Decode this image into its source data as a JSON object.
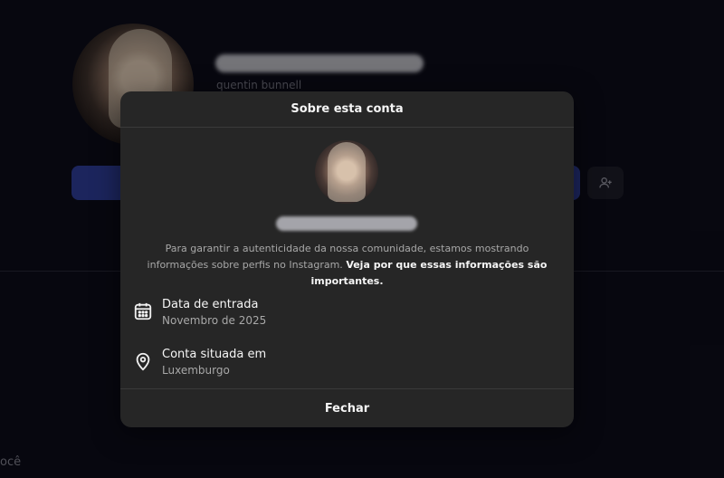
{
  "background": {
    "username": "quentin bunnell",
    "bottom_text": "ocê"
  },
  "modal": {
    "title": "Sobre esta conta",
    "description": "Para garantir a autenticidade da nossa comunidade, estamos mostrando informações sobre perfis no Instagram.",
    "description_link": "Veja por que essas informações são importantes.",
    "rows": [
      {
        "icon": "calendar-icon",
        "title": "Data de entrada",
        "value": "Novembro de 2025"
      },
      {
        "icon": "location-pin-icon",
        "title": "Conta situada em",
        "value": "Luxemburgo"
      }
    ],
    "close_label": "Fechar"
  },
  "colors": {
    "page_bg": "#0c0c18",
    "modal_bg": "#262626",
    "primary_button": "#2c3a8f",
    "muted_text": "#a8a8a8"
  }
}
